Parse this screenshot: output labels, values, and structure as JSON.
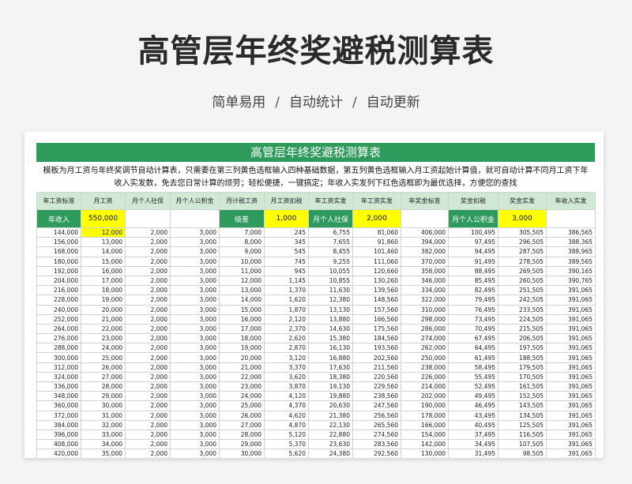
{
  "page": {
    "title": "高管层年终奖避税测算表",
    "subtitle": [
      "简单易用",
      "自动统计",
      "自动更新"
    ],
    "subtitle_sep": "/"
  },
  "sheet": {
    "banner": "高管层年终奖避税测算表",
    "description": "模板为月工资与年终奖调节自动计算表，只需要在第三列黄色选框输入四种基础数据，第五列黄色选框输入月工资起始计算值，就可自动计算不同月工资下年收入实发数，免去您日常计算的烦劳；轻松便捷，一键搞定；年收入实发列下红色选框即为最优选择，方便您的查找",
    "params": [
      {
        "label": "年收入",
        "value": "550,000"
      },
      {
        "label": "级差",
        "value": "1,000"
      },
      {
        "label": "月个人社保",
        "value": "2,000"
      },
      {
        "label": "月个人公积金",
        "value": "3,000"
      }
    ],
    "headers": [
      "年工资标准",
      "月工资",
      "月个人社保",
      "月个人公积金",
      "月计税工资",
      "月工资扣税",
      "年工资实发",
      "年工资实发",
      "年奖金标准",
      "奖金扣税",
      "奖金实发",
      "年收入实发"
    ],
    "rows": [
      [
        "144,000",
        "12,000",
        "2,000",
        "3,000",
        "7,000",
        "245",
        "6,755",
        "81,060",
        "406,000",
        "100,495",
        "305,505",
        "386,565"
      ],
      [
        "156,000",
        "13,000",
        "2,000",
        "3,000",
        "8,000",
        "345",
        "7,655",
        "91,860",
        "394,000",
        "97,495",
        "296,505",
        "388,365"
      ],
      [
        "168,000",
        "14,000",
        "2,000",
        "3,000",
        "9,000",
        "545",
        "8,455",
        "101,460",
        "382,000",
        "94,495",
        "287,505",
        "388,965"
      ],
      [
        "180,000",
        "15,000",
        "2,000",
        "3,000",
        "10,000",
        "745",
        "9,255",
        "111,060",
        "370,000",
        "91,495",
        "278,505",
        "389,565"
      ],
      [
        "192,000",
        "16,000",
        "2,000",
        "3,000",
        "11,000",
        "945",
        "10,055",
        "120,660",
        "358,000",
        "88,495",
        "269,505",
        "390,165"
      ],
      [
        "204,000",
        "17,000",
        "2,000",
        "3,000",
        "12,000",
        "1,145",
        "10,855",
        "130,260",
        "346,000",
        "85,495",
        "260,505",
        "390,765"
      ],
      [
        "216,000",
        "18,000",
        "2,000",
        "3,000",
        "13,000",
        "1,370",
        "11,630",
        "139,560",
        "334,000",
        "82,495",
        "251,505",
        "391,065"
      ],
      [
        "228,000",
        "19,000",
        "2,000",
        "3,000",
        "14,000",
        "1,620",
        "12,380",
        "148,560",
        "322,000",
        "79,495",
        "242,505",
        "391,065"
      ],
      [
        "240,000",
        "20,000",
        "2,000",
        "3,000",
        "15,000",
        "1,870",
        "13,130",
        "157,560",
        "310,000",
        "76,495",
        "233,505",
        "391,065"
      ],
      [
        "252,000",
        "21,000",
        "2,000",
        "3,000",
        "16,000",
        "2,120",
        "13,880",
        "166,560",
        "298,000",
        "73,495",
        "224,505",
        "391,065"
      ],
      [
        "264,000",
        "22,000",
        "2,000",
        "3,000",
        "17,000",
        "2,370",
        "14,630",
        "175,560",
        "286,000",
        "70,495",
        "215,505",
        "391,065"
      ],
      [
        "276,000",
        "23,000",
        "2,000",
        "3,000",
        "18,000",
        "2,620",
        "15,380",
        "184,560",
        "274,000",
        "67,495",
        "206,505",
        "391,065"
      ],
      [
        "288,000",
        "24,000",
        "2,000",
        "3,000",
        "19,000",
        "2,870",
        "16,130",
        "193,560",
        "262,000",
        "64,495",
        "197,505",
        "391,065"
      ],
      [
        "300,000",
        "25,000",
        "2,000",
        "3,000",
        "20,000",
        "3,120",
        "16,880",
        "202,560",
        "250,000",
        "61,495",
        "188,505",
        "391,065"
      ],
      [
        "312,000",
        "26,000",
        "2,000",
        "3,000",
        "21,000",
        "3,370",
        "17,630",
        "211,560",
        "238,000",
        "58,495",
        "179,505",
        "391,065"
      ],
      [
        "324,000",
        "27,000",
        "2,000",
        "3,000",
        "22,000",
        "3,620",
        "18,380",
        "220,560",
        "226,000",
        "55,495",
        "170,505",
        "391,065"
      ],
      [
        "336,000",
        "28,000",
        "2,000",
        "3,000",
        "23,000",
        "3,870",
        "19,130",
        "229,560",
        "214,000",
        "52,495",
        "161,505",
        "391,065"
      ],
      [
        "348,000",
        "29,000",
        "2,000",
        "3,000",
        "24,000",
        "4,120",
        "19,880",
        "238,560",
        "202,000",
        "49,495",
        "152,505",
        "391,065"
      ],
      [
        "360,000",
        "30,000",
        "2,000",
        "3,000",
        "25,000",
        "4,370",
        "20,630",
        "247,560",
        "190,000",
        "46,495",
        "143,505",
        "391,065"
      ],
      [
        "372,000",
        "31,000",
        "2,000",
        "3,000",
        "26,000",
        "4,620",
        "21,380",
        "256,560",
        "178,000",
        "43,495",
        "134,505",
        "391,065"
      ],
      [
        "384,000",
        "32,000",
        "2,000",
        "3,000",
        "27,000",
        "4,870",
        "22,130",
        "265,560",
        "166,000",
        "40,495",
        "125,505",
        "391,065"
      ],
      [
        "396,000",
        "33,000",
        "2,000",
        "3,000",
        "28,000",
        "5,120",
        "22,880",
        "274,560",
        "154,000",
        "37,495",
        "116,505",
        "391,065"
      ],
      [
        "408,000",
        "34,000",
        "2,000",
        "3,000",
        "29,000",
        "5,370",
        "23,630",
        "283,560",
        "142,000",
        "34,495",
        "107,505",
        "391,065"
      ],
      [
        "420,000",
        "35,000",
        "2,000",
        "3,000",
        "30,000",
        "5,620",
        "24,380",
        "292,560",
        "130,000",
        "31,495",
        "98,505",
        "391,065"
      ]
    ],
    "colors": {
      "accent": "#2e9a5c",
      "header_bg": "#cfe9d5",
      "input_yellow": "#ffff00"
    }
  }
}
